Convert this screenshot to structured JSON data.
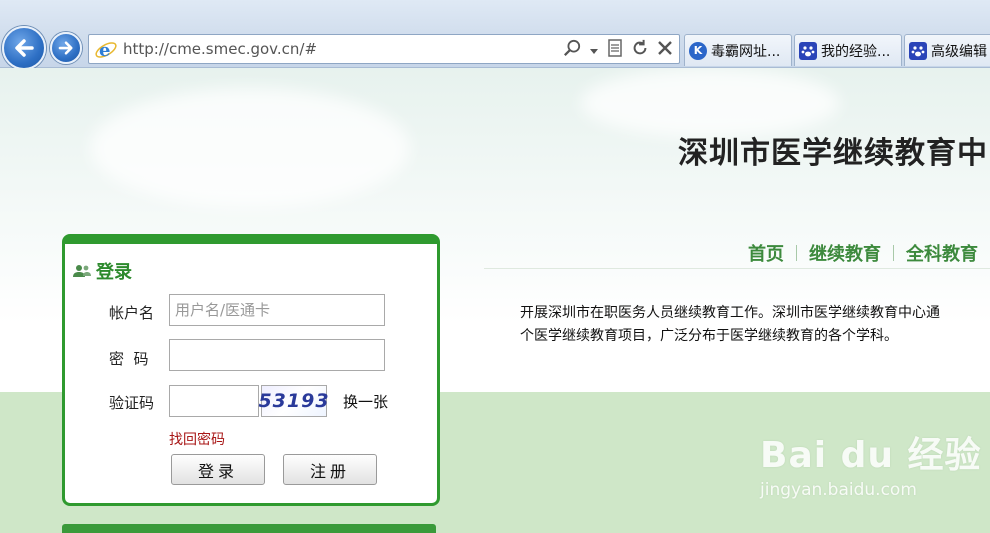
{
  "browser": {
    "url": "http://cme.smec.gov.cn/#",
    "tabs": [
      {
        "label": "毒霸网址...",
        "icon": "kingsoft-icon",
        "color": "#2b66c9"
      },
      {
        "label": "我的经验...",
        "icon": "baidu-paw-icon",
        "color": "#2a44b8"
      },
      {
        "label": "高级编辑",
        "icon": "baidu-paw-icon",
        "color": "#2a44b8"
      }
    ]
  },
  "header": {
    "site_title": "深圳市医学继续教育中",
    "nav": [
      "首页",
      "继续教育",
      "全科教育"
    ]
  },
  "intro": {
    "line1": "开展深圳市在职医务人员继续教育工作。深圳市医学继续教育中心通",
    "line2": "个医学继续教育项目，广泛分布于医学继续教育的各个学科。"
  },
  "login": {
    "title": "登录",
    "account_label": "帐户名",
    "account_placeholder": "用户名/医通卡",
    "password_label": "密  码",
    "captcha_label": "验证码",
    "captcha_code": "53193",
    "refresh_label": "换一张",
    "forgot_label": "找回密码",
    "login_button": "登录",
    "register_button": "注册"
  },
  "watermark": {
    "main": "Bai du 经验",
    "sub": "jingyan.baidu.com"
  },
  "colors": {
    "accent_green": "#2f9a2f",
    "nav_green": "#3d8a3d",
    "forgot_red": "#a81616"
  }
}
